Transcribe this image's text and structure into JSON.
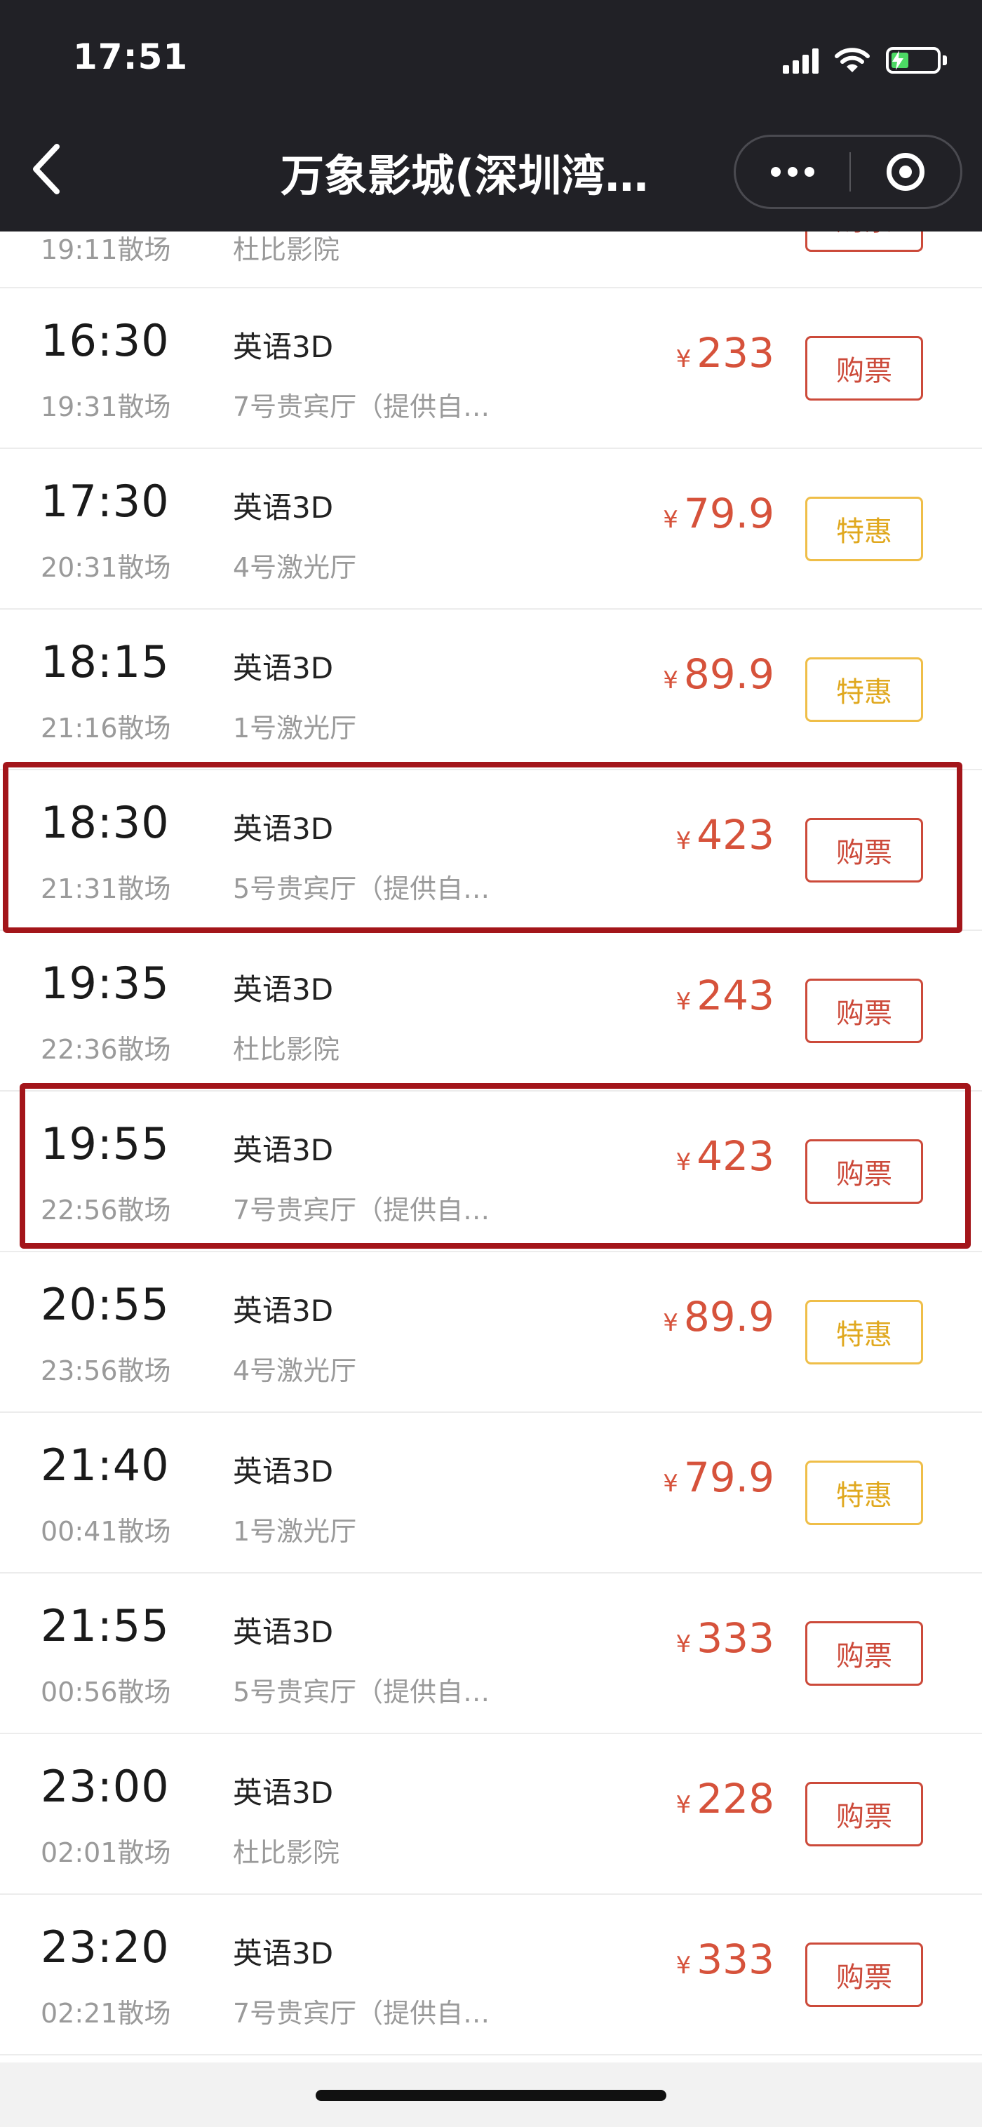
{
  "status": {
    "time": "17:51"
  },
  "nav": {
    "title": "万象影城(深圳湾…"
  },
  "colors": {
    "accent_red": "#cc4a3a",
    "deal_yellow": "#e0a81e",
    "highlight_box": "#a3151a",
    "top_bar": "#212126"
  },
  "icons": {
    "back": "chevron-left-icon",
    "more": "more-dots-icon",
    "close": "target-circle-icon",
    "signal": "signal-icon",
    "wifi": "wifi-icon",
    "battery": "battery-charging-icon"
  },
  "partial_row": {
    "end": "19:11散场",
    "hall": "杜比影院"
  },
  "rows": [
    {
      "time": "16:30",
      "end": "19:31散场",
      "lang": "英语3D",
      "hall": "7号贵宾厅（提供自…",
      "yen": "¥",
      "price": "233",
      "btn": "购票",
      "highlighted": false
    },
    {
      "time": "17:30",
      "end": "20:31散场",
      "lang": "英语3D",
      "hall": "4号激光厅",
      "yen": "¥",
      "price": "79.9",
      "btn": "特惠",
      "highlighted": false
    },
    {
      "time": "18:15",
      "end": "21:16散场",
      "lang": "英语3D",
      "hall": "1号激光厅",
      "yen": "¥",
      "price": "89.9",
      "btn": "特惠",
      "highlighted": false
    },
    {
      "time": "18:30",
      "end": "21:31散场",
      "lang": "英语3D",
      "hall": "5号贵宾厅（提供自…",
      "yen": "¥",
      "price": "423",
      "btn": "购票",
      "highlighted": true
    },
    {
      "time": "19:35",
      "end": "22:36散场",
      "lang": "英语3D",
      "hall": "杜比影院",
      "yen": "¥",
      "price": "243",
      "btn": "购票",
      "highlighted": false
    },
    {
      "time": "19:55",
      "end": "22:56散场",
      "lang": "英语3D",
      "hall": "7号贵宾厅（提供自…",
      "yen": "¥",
      "price": "423",
      "btn": "购票",
      "highlighted": true
    },
    {
      "time": "20:55",
      "end": "23:56散场",
      "lang": "英语3D",
      "hall": "4号激光厅",
      "yen": "¥",
      "price": "89.9",
      "btn": "特惠",
      "highlighted": false
    },
    {
      "time": "21:40",
      "end": "00:41散场",
      "lang": "英语3D",
      "hall": "1号激光厅",
      "yen": "¥",
      "price": "79.9",
      "btn": "特惠",
      "highlighted": false
    },
    {
      "time": "21:55",
      "end": "00:56散场",
      "lang": "英语3D",
      "hall": "5号贵宾厅（提供自…",
      "yen": "¥",
      "price": "333",
      "btn": "购票",
      "highlighted": false
    },
    {
      "time": "23:00",
      "end": "02:01散场",
      "lang": "英语3D",
      "hall": "杜比影院",
      "yen": "¥",
      "price": "228",
      "btn": "购票",
      "highlighted": false
    },
    {
      "time": "23:20",
      "end": "02:21散场",
      "lang": "英语3D",
      "hall": "7号贵宾厅（提供自…",
      "yen": "¥",
      "price": "333",
      "btn": "购票",
      "highlighted": false
    }
  ]
}
